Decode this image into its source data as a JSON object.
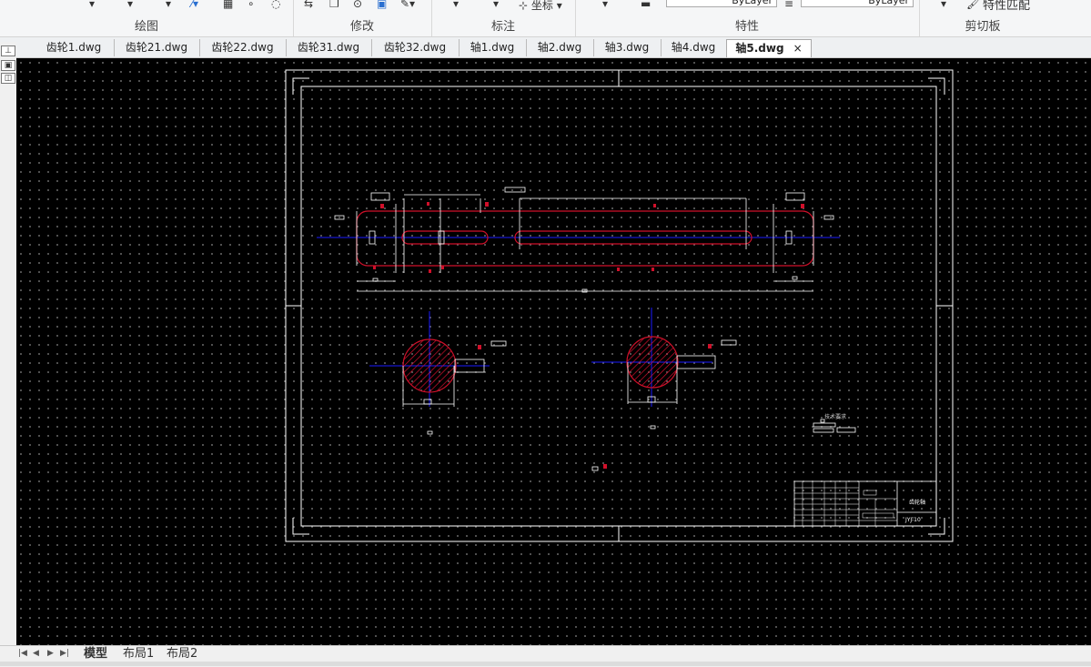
{
  "ribbon": {
    "groups": [
      "绘图",
      "修改",
      "标注",
      "特性",
      "剪切板"
    ],
    "annot_coord": "坐标",
    "linetype_value": "ByLayer",
    "lineweight_value": "ByLayer",
    "match_props": "特性匹配"
  },
  "file_tabs": [
    "齿轮1.dwg",
    "齿轮21.dwg",
    "齿轮22.dwg",
    "齿轮31.dwg",
    "齿轮32.dwg",
    "轴1.dwg",
    "轴2.dwg",
    "轴3.dwg",
    "轴4.dwg",
    "轴5.dwg"
  ],
  "active_tab": "轴5.dwg",
  "close_glyph": "×",
  "layout_tabs": [
    "模型",
    "布局1",
    "布局2"
  ],
  "nav_glyphs": [
    "|◀",
    "◀",
    "▶",
    "▶|"
  ],
  "drawing": {
    "tech_req": "技术要求",
    "title_block_name": "齿轮轴",
    "drawing_no": "JYJ-10"
  },
  "colors": {
    "canvas_bg": "#000000",
    "outline": "#ffffff",
    "axis": "#1a1aff",
    "hatch": "#d0102a",
    "dims": "#ffffff"
  },
  "icons": [
    "line-icon",
    "hatch-icon",
    "move-icon",
    "circle-icon",
    "copy-icon",
    "coord-icon",
    "layer-icon",
    "match-properties-icon"
  ]
}
